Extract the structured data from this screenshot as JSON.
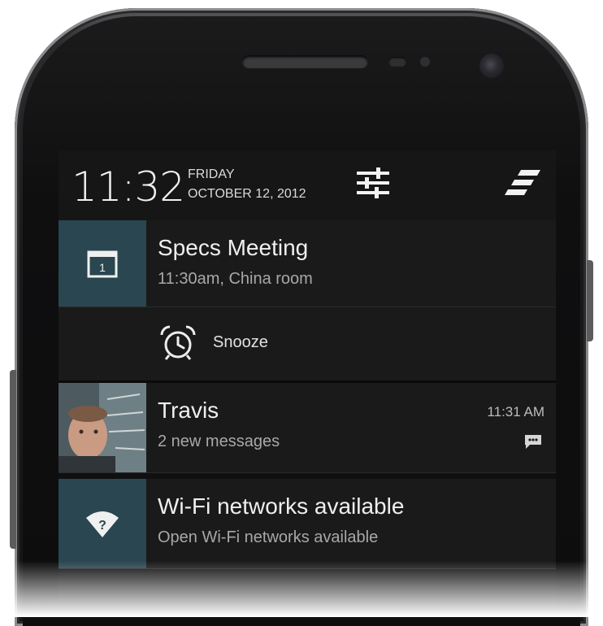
{
  "status_header": {
    "time": "11:32",
    "day": "FRIDAY",
    "date": "OCTOBER 12, 2012",
    "settings_icon": "quick-settings-sliders-icon",
    "clear_icon": "clear-all-notifications-icon"
  },
  "notifications": [
    {
      "title": "Specs Meeting",
      "subtitle": "11:30am, China room",
      "icon": "calendar-icon",
      "calendar_day": "1",
      "accent": "#2a4650",
      "action": {
        "label": "Snooze",
        "icon": "alarm-clock-icon"
      }
    },
    {
      "title": "Travis",
      "subtitle": "2 new messages",
      "time": "11:31 AM",
      "icon": "contact-photo",
      "badge_icon": "message-icon"
    },
    {
      "title": "Wi-Fi networks available",
      "subtitle": "Open Wi-Fi networks available",
      "icon": "wifi-icon",
      "accent": "#2a4650"
    }
  ]
}
